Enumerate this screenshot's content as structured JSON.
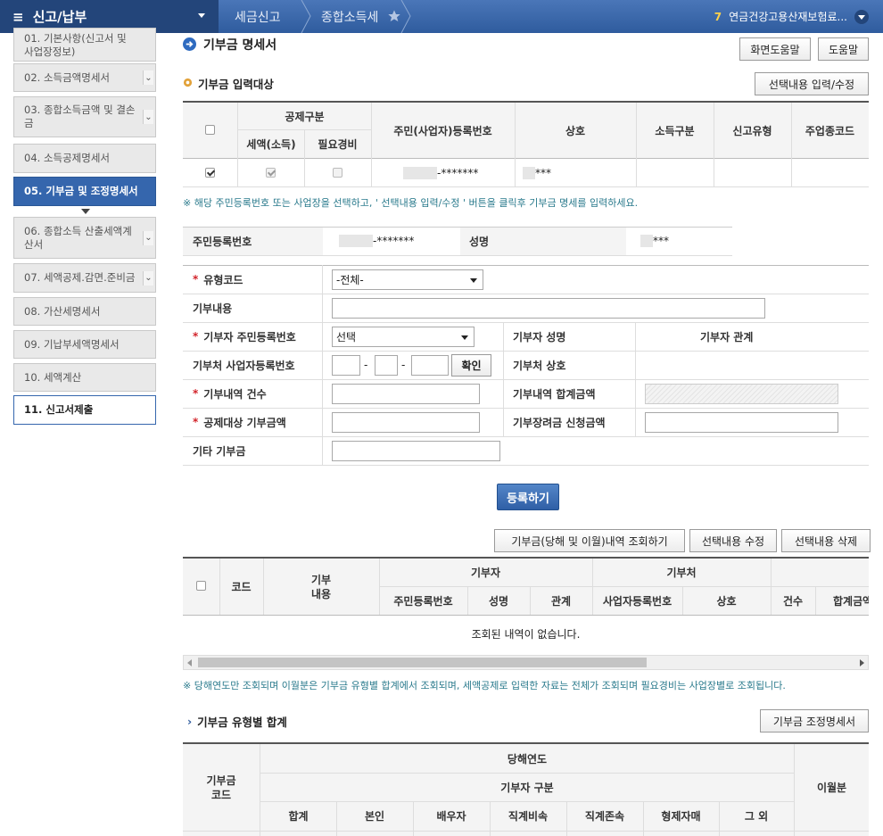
{
  "topbar": {
    "menu_label": "신고/납부",
    "crumb1": "세금신고",
    "crumb2": "종합소득세",
    "notice_count": "7",
    "notice_text": "연금건강고용산재보험료..."
  },
  "sidebar": {
    "items": [
      {
        "label": "01. 기본사항(신고서 및\n사업장정보)"
      },
      {
        "label": "02. 소득금액명세서"
      },
      {
        "label": "03. 종합소득금액 및 결손금"
      },
      {
        "label": "04. 소득공제명세서"
      },
      {
        "label": "05. 기부금 및 조정명세서"
      },
      {
        "label": "06. 종합소득 산출세액계산서"
      },
      {
        "label": "07. 세액공제.감면.준비금"
      },
      {
        "label": "08. 가산세명세서"
      },
      {
        "label": "09. 기납부세액명세서"
      },
      {
        "label": "10. 세액계산"
      },
      {
        "label": "11. 신고서제출"
      }
    ]
  },
  "page": {
    "title": "기부금 명세서",
    "help_screen": "화면도움말",
    "help": "도움말"
  },
  "target": {
    "title": "기부금 입력대상",
    "edit_button": "선택내용 입력/수정",
    "headers": {
      "group": "공제구분",
      "tax": "세액(소득)",
      "expense": "필요경비",
      "rrn": "주민(사업자)등록번호",
      "company": "상호",
      "income_type": "소득구분",
      "filing_type": "신고유형",
      "biz_code": "주업종코드"
    },
    "row": {
      "rrn": "-*******",
      "company": "***"
    },
    "note": "※ 해당 주민등록번호 또는 사업장을 선택하고, ' 선택내용 입력/수정 ' 버튼을 클릭후 기부금 명세를 입력하세요."
  },
  "person": {
    "rrn_label": "주민등록번호",
    "rrn_value": "-*******",
    "name_label": "성명",
    "name_value": "***"
  },
  "form": {
    "type_code": "유형코드",
    "type_code_value": "-전체-",
    "content": "기부내용",
    "donor_rrn": "기부자 주민등록번호",
    "donor_rrn_value": "선택",
    "donor_name": "기부자 성명",
    "donor_relation": "기부자 관계",
    "org_bizno": "기부처 사업자등록번호",
    "confirm": "확인",
    "org_name": "기부처 상호",
    "count": "기부내역 건수",
    "total": "기부내역 합계금액",
    "deductible": "공제대상 기부금액",
    "scholarship": "기부장려금 신청금액",
    "other": "기타 기부금",
    "dash": "-",
    "register": "등록하기"
  },
  "list": {
    "query_button": "기부금(당해 및 이월)내역 조회하기",
    "edit_button": "선택내용 수정",
    "delete_button": "선택내용 삭제",
    "headers": {
      "code": "코드",
      "content": "기부\n내용",
      "donor": "기부자",
      "org": "기부처",
      "rrn": "주민등록번호",
      "name": "성명",
      "relation": "관계",
      "bizno": "사업자등록번호",
      "company": "상호",
      "count": "건수",
      "total": "합계금액"
    },
    "empty": "조회된 내역이 없습니다.",
    "note": "※ 당해연도만 조회되며 이월분은 기부금 유형별 합계에서 조회되며, 세액공제로 입력한 자료는 전체가 조회되며 필요경비는 사업장별로 조회됩니다."
  },
  "summary": {
    "title": "기부금 유형별 합계",
    "button": "기부금 조정명세서",
    "headers": {
      "code": "기부금\n코드",
      "current_year": "당해연도",
      "donor_type": "기부자 구분",
      "carryover": "이월분",
      "total": "합계",
      "self": "본인",
      "spouse": "배우자",
      "ascendant": "직계비속",
      "descendant": "직계존속",
      "sibling": "형제자매",
      "other": "그 외"
    }
  },
  "colors": {
    "brand": "#2f5c9e",
    "active": "#3566ad",
    "required": "#d2232a",
    "note": "#2a7a8c"
  }
}
